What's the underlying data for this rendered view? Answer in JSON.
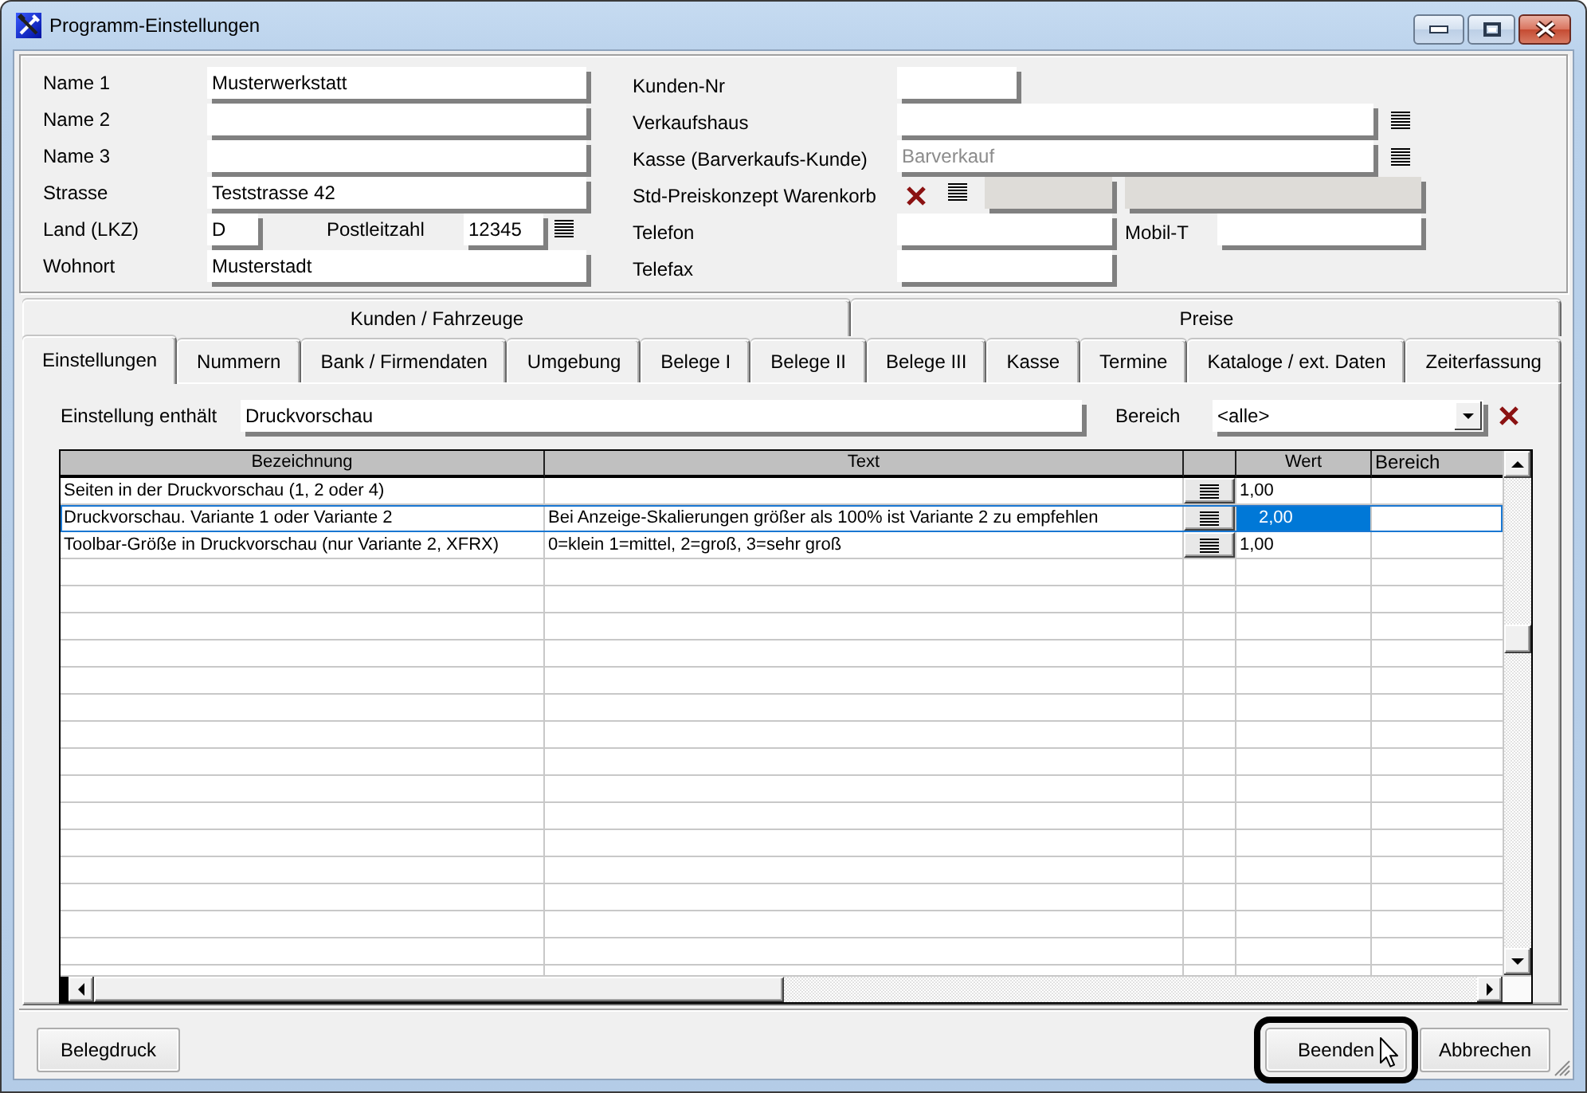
{
  "window": {
    "title": "Programm-Einstellungen"
  },
  "address_panel": {
    "left_rows": [
      {
        "kind": "text",
        "label": "Name 1",
        "value": "Musterwerkstatt"
      },
      {
        "kind": "text",
        "label": "Name 2"
      },
      {
        "kind": "text",
        "label": "Name 3"
      },
      {
        "kind": "text",
        "label": "Strasse",
        "value": "Teststrasse 42"
      },
      {
        "kind": "country_zip",
        "label": "Land (LKZ)",
        "value": "D",
        "zip_label": "Postleitzahl",
        "zip_value": "12345"
      },
      {
        "kind": "text",
        "label": "Wohnort",
        "value": "Musterstadt"
      }
    ],
    "right_rows": [
      {
        "kind": "short",
        "label": "Kunden-Nr",
        "disabled": false
      },
      {
        "kind": "lookup",
        "label": "Verkaufshaus",
        "disabled": false
      },
      {
        "kind": "lookup",
        "label": "Kasse (Barverkaufs-Kunde)",
        "placeholder": "Barverkauf",
        "disabled": false
      },
      {
        "kind": "price_concept",
        "label": "Std-Preiskonzept Warenkorb",
        "disabled": true
      },
      {
        "kind": "phone",
        "label": "Telefon",
        "extra_label": "Mobil-T",
        "disabled": false
      },
      {
        "kind": "medium",
        "label": "Telefax",
        "disabled": false
      }
    ]
  },
  "tab_rows": [
    {
      "tabs": [
        {
          "label": "Kunden / Fahrzeuge",
          "selected": false
        },
        {
          "label": "Preise",
          "selected": false
        }
      ]
    },
    {
      "tabs": [
        {
          "label": "Einstellungen",
          "selected": true
        },
        {
          "label": "Nummern",
          "selected": false
        },
        {
          "label": "Bank / Firmendaten",
          "selected": false
        },
        {
          "label": "Umgebung",
          "selected": false
        },
        {
          "label": "Belege I",
          "selected": false
        },
        {
          "label": "Belege II",
          "selected": false
        },
        {
          "label": "Belege III",
          "selected": false
        },
        {
          "label": "Kasse",
          "selected": false
        },
        {
          "label": "Termine",
          "selected": false
        },
        {
          "label": "Kataloge / ext. Daten",
          "selected": false
        },
        {
          "label": "Zeiterfassung",
          "selected": false
        }
      ]
    }
  ],
  "filter": {
    "label": "Einstellung enthält",
    "value": "Druckvorschau",
    "area_label": "Bereich",
    "area_value": "<alle>"
  },
  "table": {
    "columns": [
      {
        "kind": "text",
        "label": "Bezeichnung"
      },
      {
        "kind": "text",
        "label": "Text"
      },
      {
        "kind": "button"
      },
      {
        "kind": "text",
        "label": "Wert"
      },
      {
        "kind": "text",
        "label": "Bereich"
      }
    ],
    "rows": [
      {
        "name": "Seiten in der Druckvorschau (1, 2 oder 4)",
        "value": "1,00",
        "selected": false
      },
      {
        "name": "Druckvorschau. Variante 1 oder Variante 2",
        "text": "Bei Anzeige-Skalierungen größer als 100% ist Variante 2 zu empfehlen",
        "value": "2,00",
        "selected": true
      },
      {
        "name": "Toolbar-Größe in Druckvorschau (nur Variante 2, XFRX)",
        "text": "0=klein 1=mittel, 2=groß, 3=sehr groß",
        "value": "1,00",
        "selected": false
      }
    ]
  },
  "buttons": [
    {
      "label": "Belegdruck",
      "focused": false
    },
    {
      "label": "Beenden",
      "focused": true
    },
    {
      "label": "Abbrechen",
      "focused": false
    }
  ]
}
